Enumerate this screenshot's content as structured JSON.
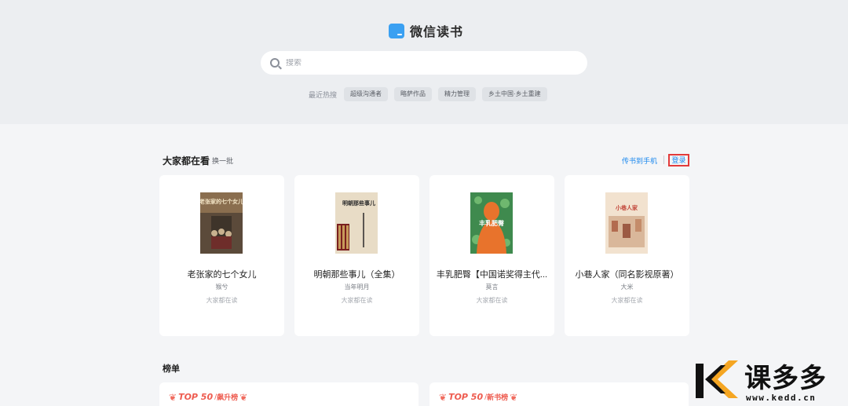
{
  "header": {
    "app_name": "微信读书",
    "search_placeholder": "搜索",
    "hot_label": "最近热搜",
    "hot_tags": [
      "超级沟通者",
      "略萨作品",
      "精力管理",
      "乡土中国·乡土重建"
    ]
  },
  "section": {
    "title": "大家都在看",
    "refresh": "换一批",
    "send_to_phone": "传书到手机",
    "login": "登录"
  },
  "books": [
    {
      "title": "老张家的七个女儿",
      "author": "猴兮",
      "tag": "大家都在读",
      "cover_text": "老张家的七个女儿"
    },
    {
      "title": "明朝那些事儿（全集）",
      "author": "当年明月",
      "tag": "大家都在读",
      "cover_text": "明朝那些事儿"
    },
    {
      "title": "丰乳肥臀【中国诺奖得主代...",
      "author": "莫言",
      "tag": "大家都在读",
      "cover_text": "丰乳肥臀"
    },
    {
      "title": "小巷人家（同名影视原著）",
      "author": "大米",
      "tag": "大家都在读",
      "cover_text": "小巷人家"
    }
  ],
  "rankings": {
    "title": "榜单",
    "items": [
      {
        "top": "TOP 50",
        "name": "飙升榜"
      },
      {
        "top": "TOP 50",
        "name": "新书榜"
      }
    ]
  },
  "watermark": {
    "brand": "课多多",
    "url": "www.kedd.cn"
  },
  "colors": {
    "accent": "#1b88ee",
    "highlight_border": "#e23b3b",
    "rank_red": "#ee5b4f"
  }
}
